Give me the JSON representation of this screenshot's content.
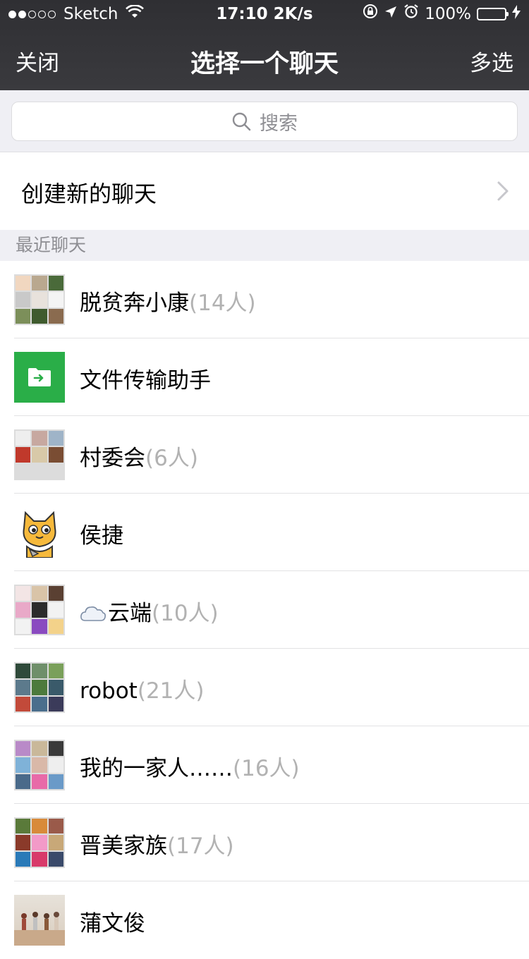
{
  "status_bar": {
    "carrier": "Sketch",
    "time_speed": "17:10 2K/s",
    "battery": "100%",
    "battery_level": 1.0
  },
  "nav": {
    "left": "关闭",
    "title": "选择一个聊天",
    "right": "多选"
  },
  "search": {
    "placeholder": "搜索"
  },
  "new_chat": {
    "label": "创建新的聊天"
  },
  "section": {
    "title": "最近聊天"
  },
  "chats": [
    {
      "name": "脱贫奔小康",
      "count": "(14人)",
      "avatar": "group-grid"
    },
    {
      "name": "文件传输助手",
      "count": "",
      "avatar": "file-transfer-icon"
    },
    {
      "name": "村委会",
      "count": "(6人)",
      "avatar": "group-grid"
    },
    {
      "name": "侯捷",
      "count": "",
      "avatar": "cartoon-cat"
    },
    {
      "name": "云端",
      "count": "(10人)",
      "avatar": "group-grid",
      "prefix_icon": "cloud-icon"
    },
    {
      "name": "robot",
      "count": "(21人)",
      "avatar": "group-grid"
    },
    {
      "name": "我的一家人……",
      "count": "(16人)",
      "avatar": "group-grid"
    },
    {
      "name": "晋美家族",
      "count": "(17人)",
      "avatar": "group-grid"
    },
    {
      "name": "蒲文俊",
      "count": "",
      "avatar": "photo"
    }
  ],
  "colors": {
    "nav_bg": "#2f2f33",
    "file_transfer_green": "#2aae48",
    "battery_green": "#4cd964",
    "count_gray": "#b2b2b2"
  }
}
